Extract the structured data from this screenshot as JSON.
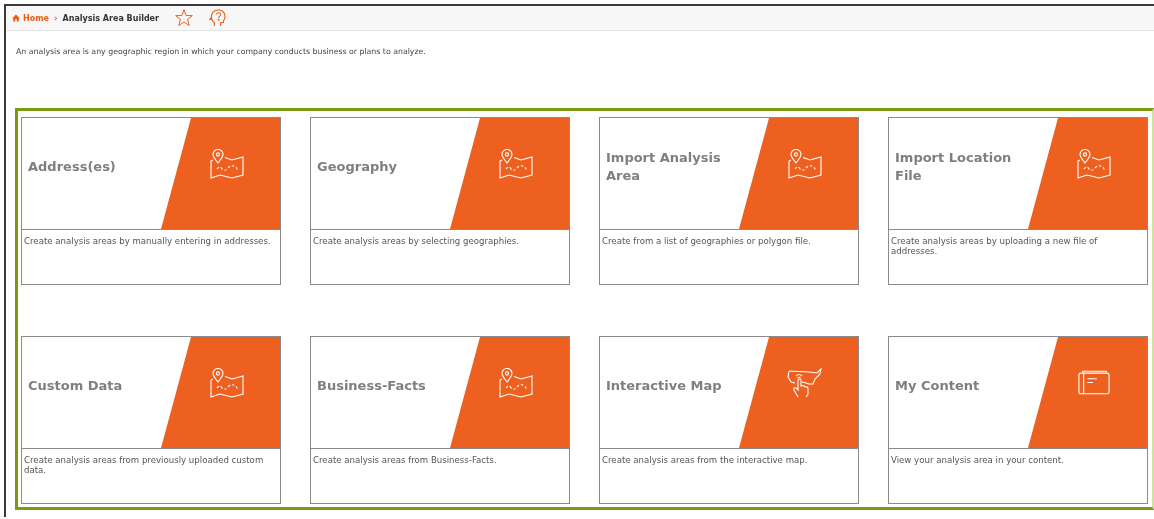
{
  "breadcrumb": {
    "home": "Home",
    "separator": "›",
    "current": "Analysis Area Builder"
  },
  "intro": "An analysis area is any geographic region in which your company conducts business or plans to analyze.",
  "cards": [
    {
      "title": "Address(es)",
      "description": "Create analysis areas by manually entering in addresses.",
      "kind": "map"
    },
    {
      "title": "Geography",
      "description": "Create analysis areas by selecting geographies.",
      "kind": "map"
    },
    {
      "title": "Import Analysis Area",
      "description": "Create from a list of geographies or polygon file.",
      "kind": "map"
    },
    {
      "title": "Import Location File",
      "description": "Create analysis areas by uploading a new file of addresses.",
      "kind": "map"
    },
    {
      "title": "Custom Data",
      "description": "Create analysis areas from previously uploaded custom data.",
      "kind": "map"
    },
    {
      "title": "Business-Facts",
      "description": "Create analysis areas from Business-Facts.",
      "kind": "map"
    },
    {
      "title": "Interactive Map",
      "description": "Create analysis areas from the interactive map.",
      "kind": "touch"
    },
    {
      "title": "My Content",
      "description": "View your analysis area in your content.",
      "kind": "folder"
    }
  ]
}
